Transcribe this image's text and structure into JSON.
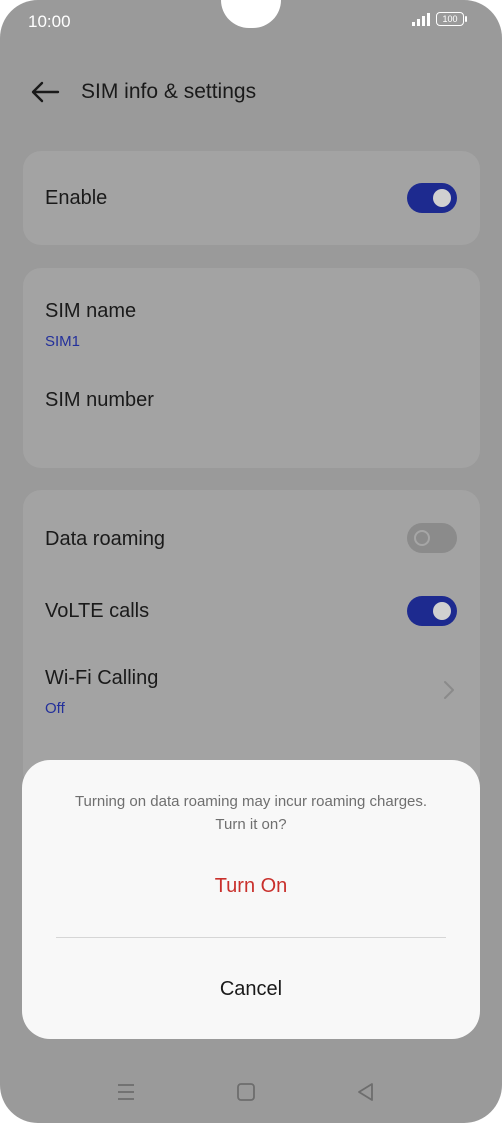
{
  "status_bar": {
    "time": "10:00",
    "battery": "100"
  },
  "header": {
    "title": "SIM info & settings"
  },
  "card_enable": {
    "label": "Enable",
    "toggle_on": true
  },
  "card_sim": {
    "name_label": "SIM name",
    "name_value": "SIM1",
    "number_label": "SIM number"
  },
  "card_network": {
    "data_roaming_label": "Data roaming",
    "data_roaming_on": false,
    "volte_label": "VoLTE calls",
    "volte_on": true,
    "wifi_calling_label": "Wi-Fi Calling",
    "wifi_calling_value": "Off"
  },
  "dialog": {
    "message": "Turning on data roaming may incur roaming charges. Turn it on?",
    "confirm_label": "Turn On",
    "cancel_label": "Cancel"
  },
  "colors": {
    "accent": "#1d2a8f",
    "confirm": "#c9302c",
    "sub_text": "#23309b"
  }
}
